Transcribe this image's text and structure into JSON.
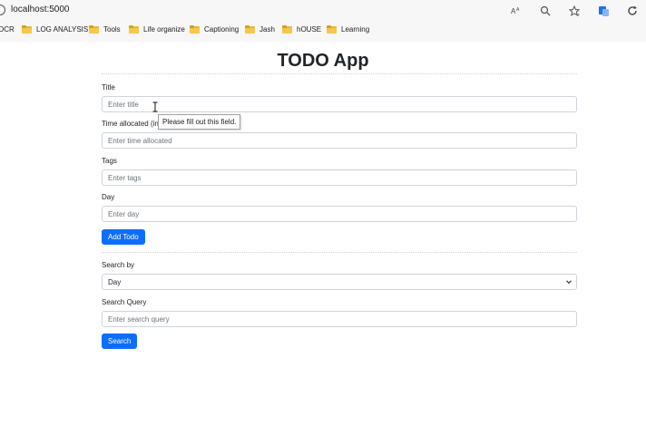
{
  "browser": {
    "url": "localhost:5000",
    "bookmarks": [
      {
        "label": "OCR",
        "folder": false
      },
      {
        "label": "LOG ANALYSIS",
        "folder": true
      },
      {
        "label": "Tools",
        "folder": true
      },
      {
        "label": "Life organize",
        "folder": true
      },
      {
        "label": "Captioning",
        "folder": true
      },
      {
        "label": "Jash",
        "folder": true
      },
      {
        "label": "hOUSE",
        "folder": true
      },
      {
        "label": "Learning",
        "folder": true
      }
    ]
  },
  "app": {
    "title": "TODO App",
    "form": {
      "title_label": "Title",
      "title_placeholder": "Enter title",
      "time_label": "Time allocated (in",
      "time_placeholder": "Enter time allocated",
      "tags_label": "Tags",
      "tags_placeholder": "Enter tags",
      "day_label": "Day",
      "day_placeholder": "Enter day",
      "add_button": "Add Todo"
    },
    "search": {
      "search_by_label": "Search by",
      "search_by_selected": "Day",
      "query_label": "Search Query",
      "query_placeholder": "Enter search query",
      "search_button": "Search"
    },
    "tooltip": "Please fill out this field."
  },
  "colors": {
    "primary": "#0d6efd",
    "input_border": "#ced4da"
  }
}
